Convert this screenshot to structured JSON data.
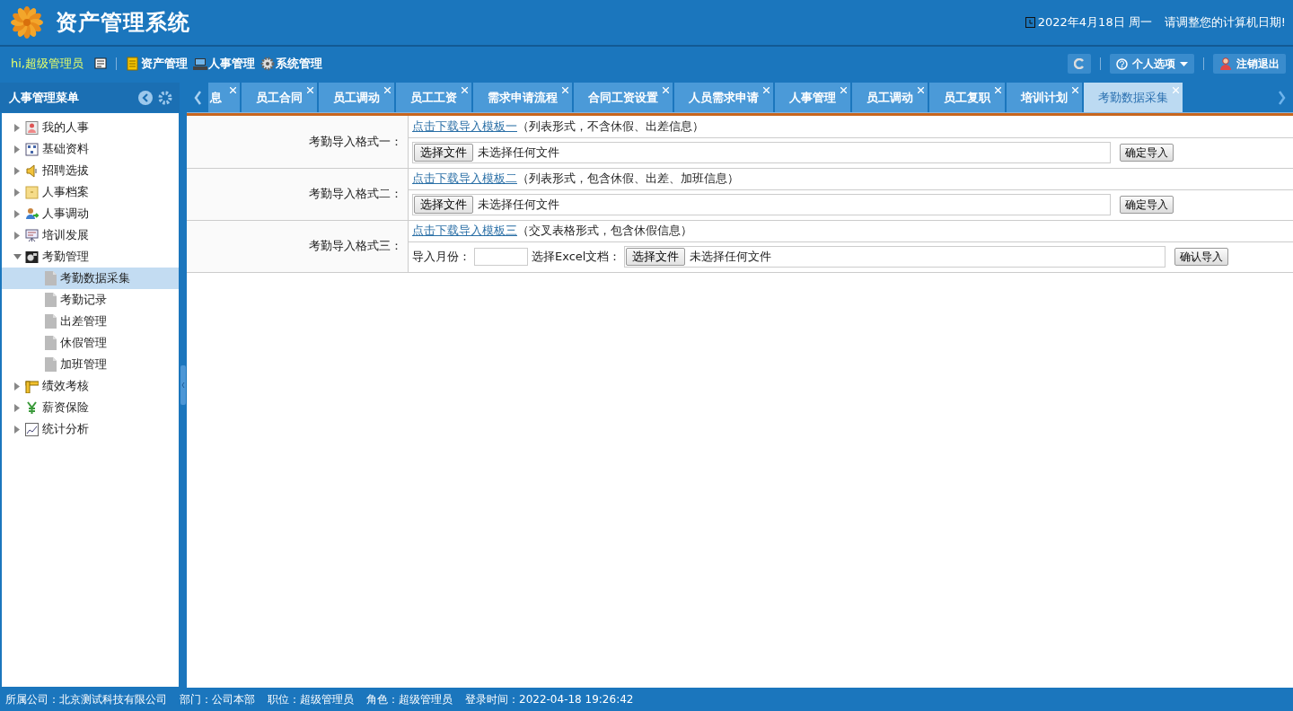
{
  "header": {
    "title": "资产管理系统",
    "date": "2022年4月18日 周一",
    "notice": "请调整您的计算机日期!"
  },
  "navbar": {
    "greeting": "hi,超级管理员",
    "modules": [
      "资产管理",
      "人事管理",
      "系统管理"
    ],
    "options": "个人选项",
    "logout": "注销退出"
  },
  "sidebar": {
    "title": "人事管理菜单",
    "items": [
      {
        "label": "我的人事",
        "expanded": false
      },
      {
        "label": "基础资料",
        "expanded": false
      },
      {
        "label": "招聘选拔",
        "expanded": false
      },
      {
        "label": "人事档案",
        "expanded": false
      },
      {
        "label": "人事调动",
        "expanded": false
      },
      {
        "label": "培训发展",
        "expanded": false
      },
      {
        "label": "考勤管理",
        "expanded": true,
        "children": [
          {
            "label": "考勤数据采集",
            "selected": true
          },
          {
            "label": "考勤记录",
            "selected": false
          },
          {
            "label": "出差管理",
            "selected": false
          },
          {
            "label": "休假管理",
            "selected": false
          },
          {
            "label": "加班管理",
            "selected": false
          }
        ]
      },
      {
        "label": "绩效考核",
        "expanded": false
      },
      {
        "label": "薪资保险",
        "expanded": false
      },
      {
        "label": "统计分析",
        "expanded": false
      }
    ]
  },
  "tabs": [
    {
      "label": "息",
      "selected": false
    },
    {
      "label": "员工合同",
      "selected": false
    },
    {
      "label": "员工调动",
      "selected": false
    },
    {
      "label": "员工工资",
      "selected": false
    },
    {
      "label": "需求申请流程",
      "selected": false
    },
    {
      "label": "合同工资设置",
      "selected": false
    },
    {
      "label": "人员需求申请",
      "selected": false
    },
    {
      "label": "人事管理",
      "selected": false
    },
    {
      "label": "员工调动",
      "selected": false
    },
    {
      "label": "员工复职",
      "selected": false
    },
    {
      "label": "培训计划",
      "selected": false
    },
    {
      "label": "考勤数据采集",
      "selected": true
    }
  ],
  "form": {
    "rows": [
      {
        "kind": "file",
        "label": "考勤导入格式一：",
        "link": "点击下载导入模板一",
        "note": "（列表形式，不含休假、出差信息）",
        "file_button": "选择文件",
        "file_status": "未选择任何文件",
        "submit": "确定导入"
      },
      {
        "kind": "file",
        "label": "考勤导入格式二：",
        "link": "点击下载导入模板二",
        "note": "（列表形式，包含休假、出差、加班信息）",
        "file_button": "选择文件",
        "file_status": "未选择任何文件",
        "submit": "确定导入"
      },
      {
        "kind": "month_file",
        "label": "考勤导入格式三：",
        "link": "点击下载导入模板三",
        "note": "（交叉表格形式，包含休假信息）",
        "month_label": "导入月份：",
        "excel_label": "选择Excel文档：",
        "file_button": "选择文件",
        "file_status": "未选择任何文件",
        "submit": "确认导入"
      }
    ]
  },
  "status_bar": [
    "所属公司：北京测试科技有限公司",
    "部门：公司本部",
    "职位：超级管理员",
    "角色：超级管理员",
    "登录时间：2022-04-18 19:26:42"
  ]
}
